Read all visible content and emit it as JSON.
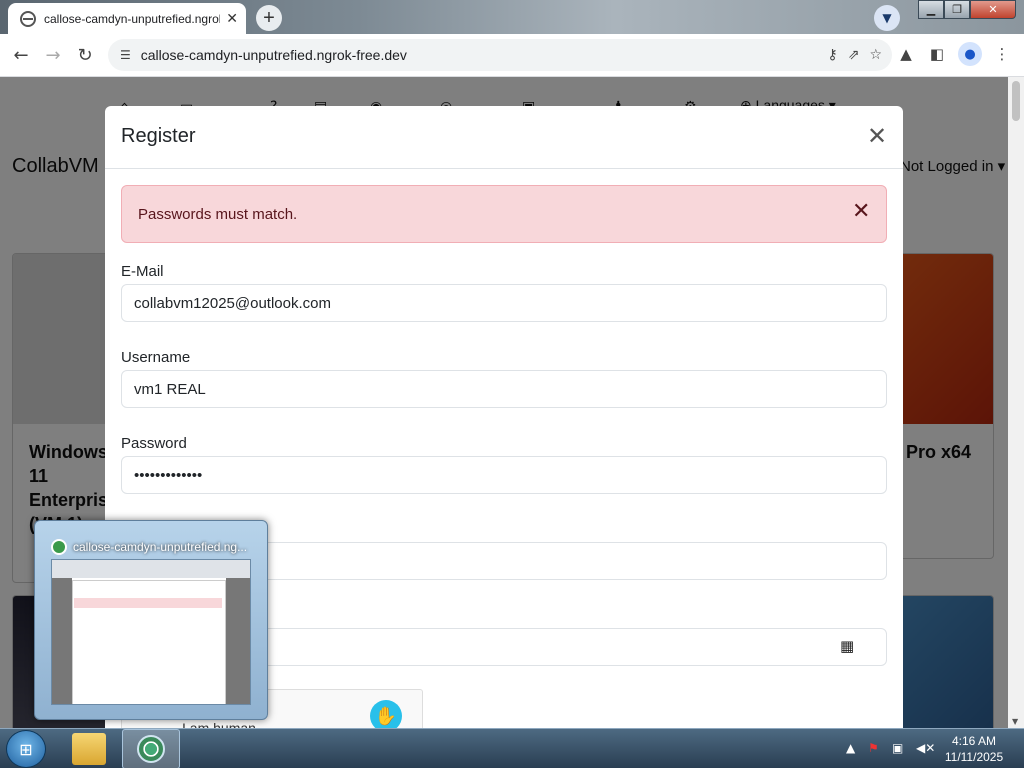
{
  "browser": {
    "tab_title": "callose-camdyn-unputrefied.ngrok-free.dev",
    "url": "callose-camdyn-unputrefied.ngrok-free.dev"
  },
  "background_page": {
    "brand": "CollabVM",
    "nav_languages": "Languages",
    "logged_in": "Not Logged in",
    "cards": [
      {
        "title": "Windows 11 Enterprise (VM 1)"
      },
      {
        "title": "Pro x64"
      }
    ]
  },
  "modal": {
    "title": "Register",
    "alert": "Passwords must match.",
    "fields": [
      {
        "label": "E-Mail",
        "value": "collabvm12025@outlook.com"
      },
      {
        "label": "Username",
        "value": "vm1 REAL"
      },
      {
        "label": "Password",
        "value": "•••••••••••••"
      }
    ],
    "captcha_label": "I am human"
  },
  "taskbar_preview": {
    "title": "callose-camdyn-unputrefied.ng..."
  },
  "taskbar": {
    "time": "4:16 AM",
    "date": "11/11/2025"
  }
}
